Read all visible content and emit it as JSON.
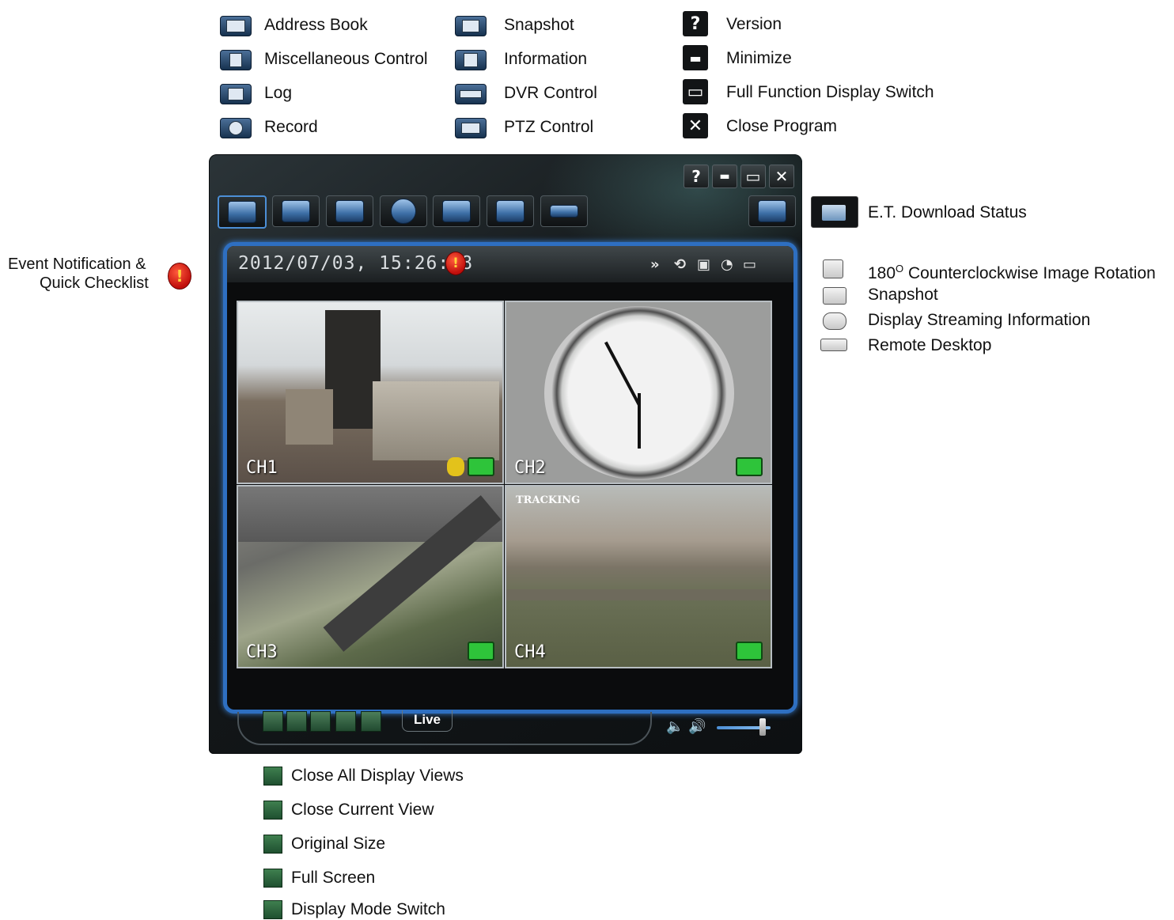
{
  "top_legend": [
    {
      "label": "Address Book",
      "icon": "address-book-icon"
    },
    {
      "label": "Miscellaneous Control",
      "icon": "misc-control-icon"
    },
    {
      "label": "Log",
      "icon": "log-icon"
    },
    {
      "label": "Record",
      "icon": "record-icon"
    },
    {
      "label": "Snapshot",
      "icon": "snapshot-icon"
    },
    {
      "label": "Information",
      "icon": "information-icon"
    },
    {
      "label": "DVR Control",
      "icon": "dvr-control-icon"
    },
    {
      "label": "PTZ Control",
      "icon": "ptz-control-icon"
    },
    {
      "label": "Version",
      "icon": "version-icon",
      "glyph": "?"
    },
    {
      "label": "Minimize",
      "icon": "minimize-icon",
      "glyph": "▬"
    },
    {
      "label": "Full Function Display Switch",
      "icon": "full-function-icon",
      "glyph": "▭"
    },
    {
      "label": "Close Program",
      "icon": "close-icon",
      "glyph": "✕"
    }
  ],
  "et_download": {
    "label": "E.T. Download Status"
  },
  "event_notification": {
    "line1": "Event Notification &",
    "line2": "Quick Checklist"
  },
  "right_legend": [
    {
      "label_main": "180",
      "label_sup": "O",
      "label_rest": " Counterclockwise Image Rotation",
      "icon": "rotate-icon"
    },
    {
      "label": "Snapshot",
      "icon": "camera-icon"
    },
    {
      "label": "Display Streaming Information",
      "icon": "streaming-info-icon"
    },
    {
      "label": "Remote Desktop",
      "icon": "remote-desktop-icon"
    }
  ],
  "bottom_legend": [
    {
      "label": "Close All Display Views",
      "icon": "close-all-views-icon"
    },
    {
      "label": "Close Current View",
      "icon": "close-current-view-icon"
    },
    {
      "label": "Original Size",
      "icon": "original-size-icon"
    },
    {
      "label": "Full Screen",
      "icon": "full-screen-icon"
    },
    {
      "label": "Display Mode Switch",
      "icon": "display-mode-icon"
    }
  ],
  "window": {
    "controls": [
      "?",
      "▬",
      "▭",
      "✕"
    ],
    "timestamp": "2012/07/03, 15:26:18",
    "live_tab": "Live",
    "header_icons": [
      "»",
      "⟲",
      "▣",
      "◔",
      "▭"
    ],
    "volume_level": 0.85,
    "channels": [
      {
        "label": "CH1"
      },
      {
        "label": "CH2"
      },
      {
        "label": "CH3"
      },
      {
        "label": "CH4",
        "overlay_text": "TRACKING"
      }
    ]
  },
  "colors": {
    "accent_blue": "#2e6fc1",
    "record_green": "#2ec43a",
    "alert_red": "#c10f0c"
  }
}
